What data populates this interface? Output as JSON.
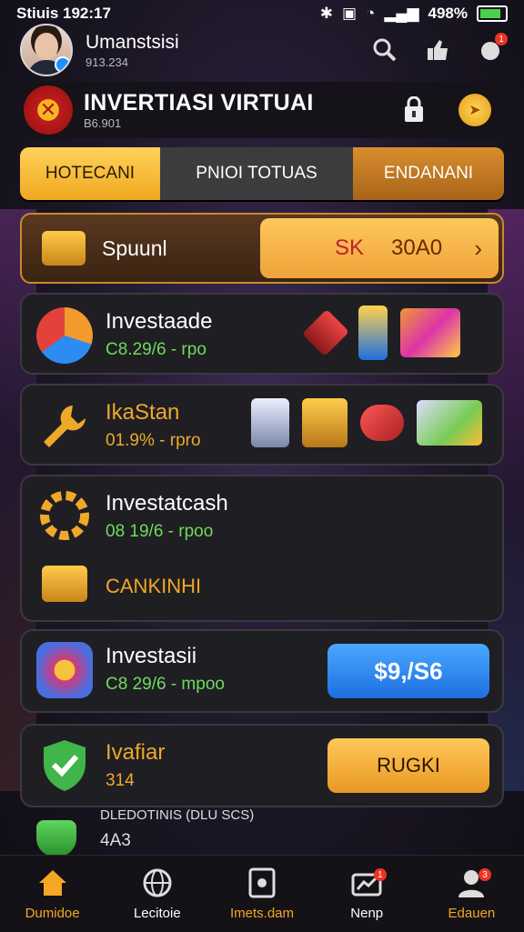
{
  "status": {
    "time": "Stiuis 192:17",
    "battery": "498%"
  },
  "profile": {
    "name": "Umanstsisi",
    "sub": "913.234"
  },
  "header": {
    "title": "INVERTIASI VIRTUAI",
    "sub": "B6.901"
  },
  "tabs": [
    {
      "label": "HOTECANI"
    },
    {
      "label": "PNIOI TOTUAS"
    },
    {
      "label": "ENDANANI"
    }
  ],
  "special": {
    "label": "Spuunl",
    "btn_a": "SK",
    "btn_b": "30A0",
    "chevron": "›"
  },
  "cards": [
    {
      "name": "Investaade",
      "sub": "C8.29/6 - rpo"
    },
    {
      "name": "IkaStan",
      "sub": "01.9% - rpro"
    },
    {
      "name": "Investatcash",
      "sub": "08 19/6 - rpoo",
      "extra": "CANKINHI"
    },
    {
      "name": "Investasii",
      "sub": "C8 29/6 - mpoo",
      "button": "$9,/S6"
    },
    {
      "name": "Ivafiar",
      "sub": "314",
      "button": "RUGKI"
    }
  ],
  "extra": {
    "line1": "DLEDOTINIS (DLU SCS)",
    "line2": "4A3"
  },
  "nav": [
    {
      "label": "Dumidoe"
    },
    {
      "label": "Lecitoie"
    },
    {
      "label": "Imets.dam"
    },
    {
      "label": "Nenp"
    },
    {
      "label": "Edauen"
    }
  ],
  "badges": {
    "header": "1",
    "nav_nenp": "1",
    "nav_edauen": "3"
  }
}
